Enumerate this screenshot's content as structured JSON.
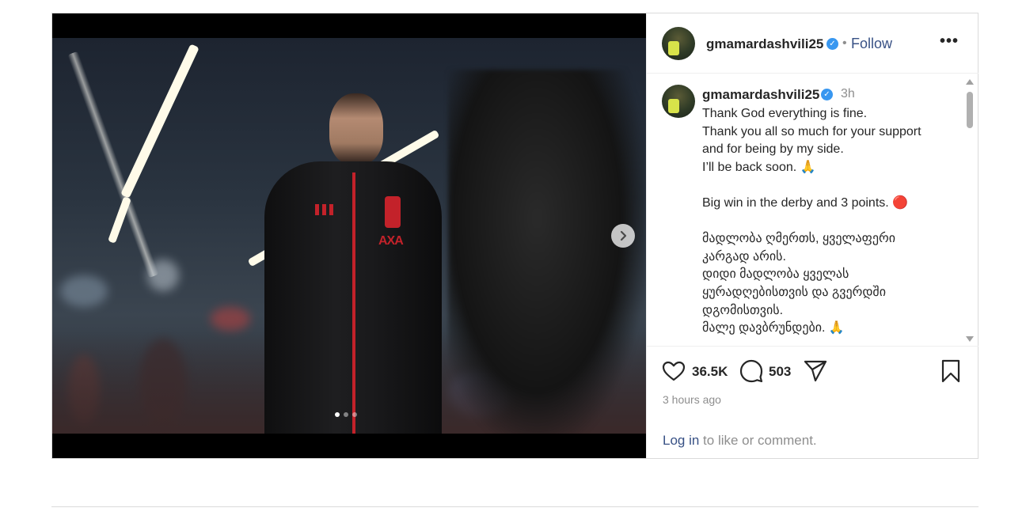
{
  "post": {
    "username": "gmamardashvili25",
    "follow_label": "Follow",
    "separator": "•",
    "more_label": "•••",
    "verified_mark": "✓",
    "time_ago": "3h",
    "caption_lines": [
      "Thank God everything is fine.",
      "Thank you all so much for your support",
      "and for being by my side.",
      "I’ll be back soon. 🙏",
      "",
      "Big win in the derby and 3 points. 🔴",
      "",
      "მადლობა ღმერთს, ყველაფერი",
      "კარგად არის.",
      "დიდი მადლობა ყველას",
      "ყურადღებისთვის და გვერდში",
      "დგომისთვის.",
      "მალე დავბრუნდები. 🙏"
    ],
    "likes": "36.5K",
    "comments": "503",
    "timestamp": "3 hours ago",
    "login_link": "Log in",
    "login_rest": " to like or comment.",
    "carousel": {
      "slides": 3,
      "active": 1,
      "next_glyph": "›"
    },
    "photo": {
      "sponsor_text": "AXA"
    }
  },
  "icons": {
    "like": "heart-icon",
    "comment": "comment-bubble-icon",
    "share": "paper-plane-icon",
    "save": "bookmark-icon",
    "next": "chevron-right-icon",
    "more": "more-options-icon"
  },
  "colors": {
    "link": "#385185",
    "muted": "#8e8e8e",
    "verified": "#3897f0",
    "text": "#262626"
  }
}
